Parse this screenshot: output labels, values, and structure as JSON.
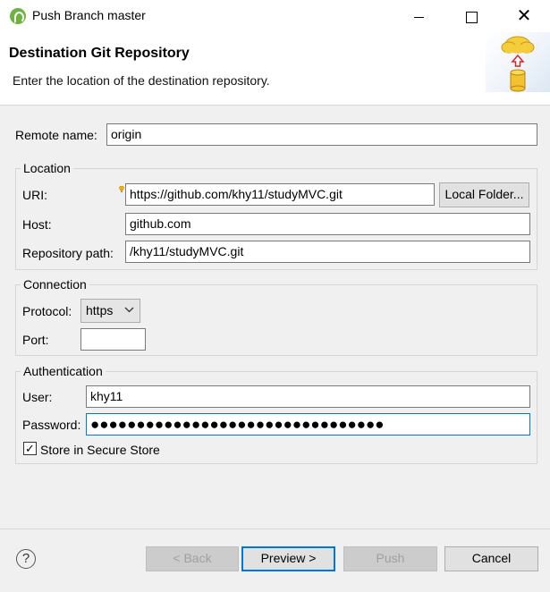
{
  "window": {
    "title": "Push Branch master",
    "minimize": "minimize",
    "maximize": "maximize",
    "close": "✕"
  },
  "header": {
    "title": "Destination Git Repository",
    "description": "Enter the location of the destination repository."
  },
  "remote": {
    "label": "Remote name:",
    "value": "origin"
  },
  "location": {
    "group_title": "Location",
    "uri_label": "URI:",
    "uri_value": "https://github.com/khy11/studyMVC.git",
    "local_folder_button": "Local Folder...",
    "host_label": "Host:",
    "host_value": "github.com",
    "repo_path_label": "Repository path:",
    "repo_path_value": "/khy11/studyMVC.git"
  },
  "connection": {
    "group_title": "Connection",
    "protocol_label": "Protocol:",
    "protocol_value": "https",
    "port_label": "Port:",
    "port_value": ""
  },
  "authentication": {
    "group_title": "Authentication",
    "user_label": "User:",
    "user_value": "khy11",
    "password_label": "Password:",
    "password_mask": "●●●●●●●●●●●●●●●●●●●●●●●●●●●●●●●●",
    "store_label": "Store in Secure Store",
    "store_checked": "✓"
  },
  "footer": {
    "help": "?",
    "back": "< Back",
    "preview": "Preview >",
    "push": "Push",
    "cancel": "Cancel"
  },
  "icons": {
    "app": "spring-eclipse-icon",
    "banner": "cloud-push-database-icon",
    "help": "help-icon",
    "uri_decorator": "content-assist-bulb-icon"
  }
}
